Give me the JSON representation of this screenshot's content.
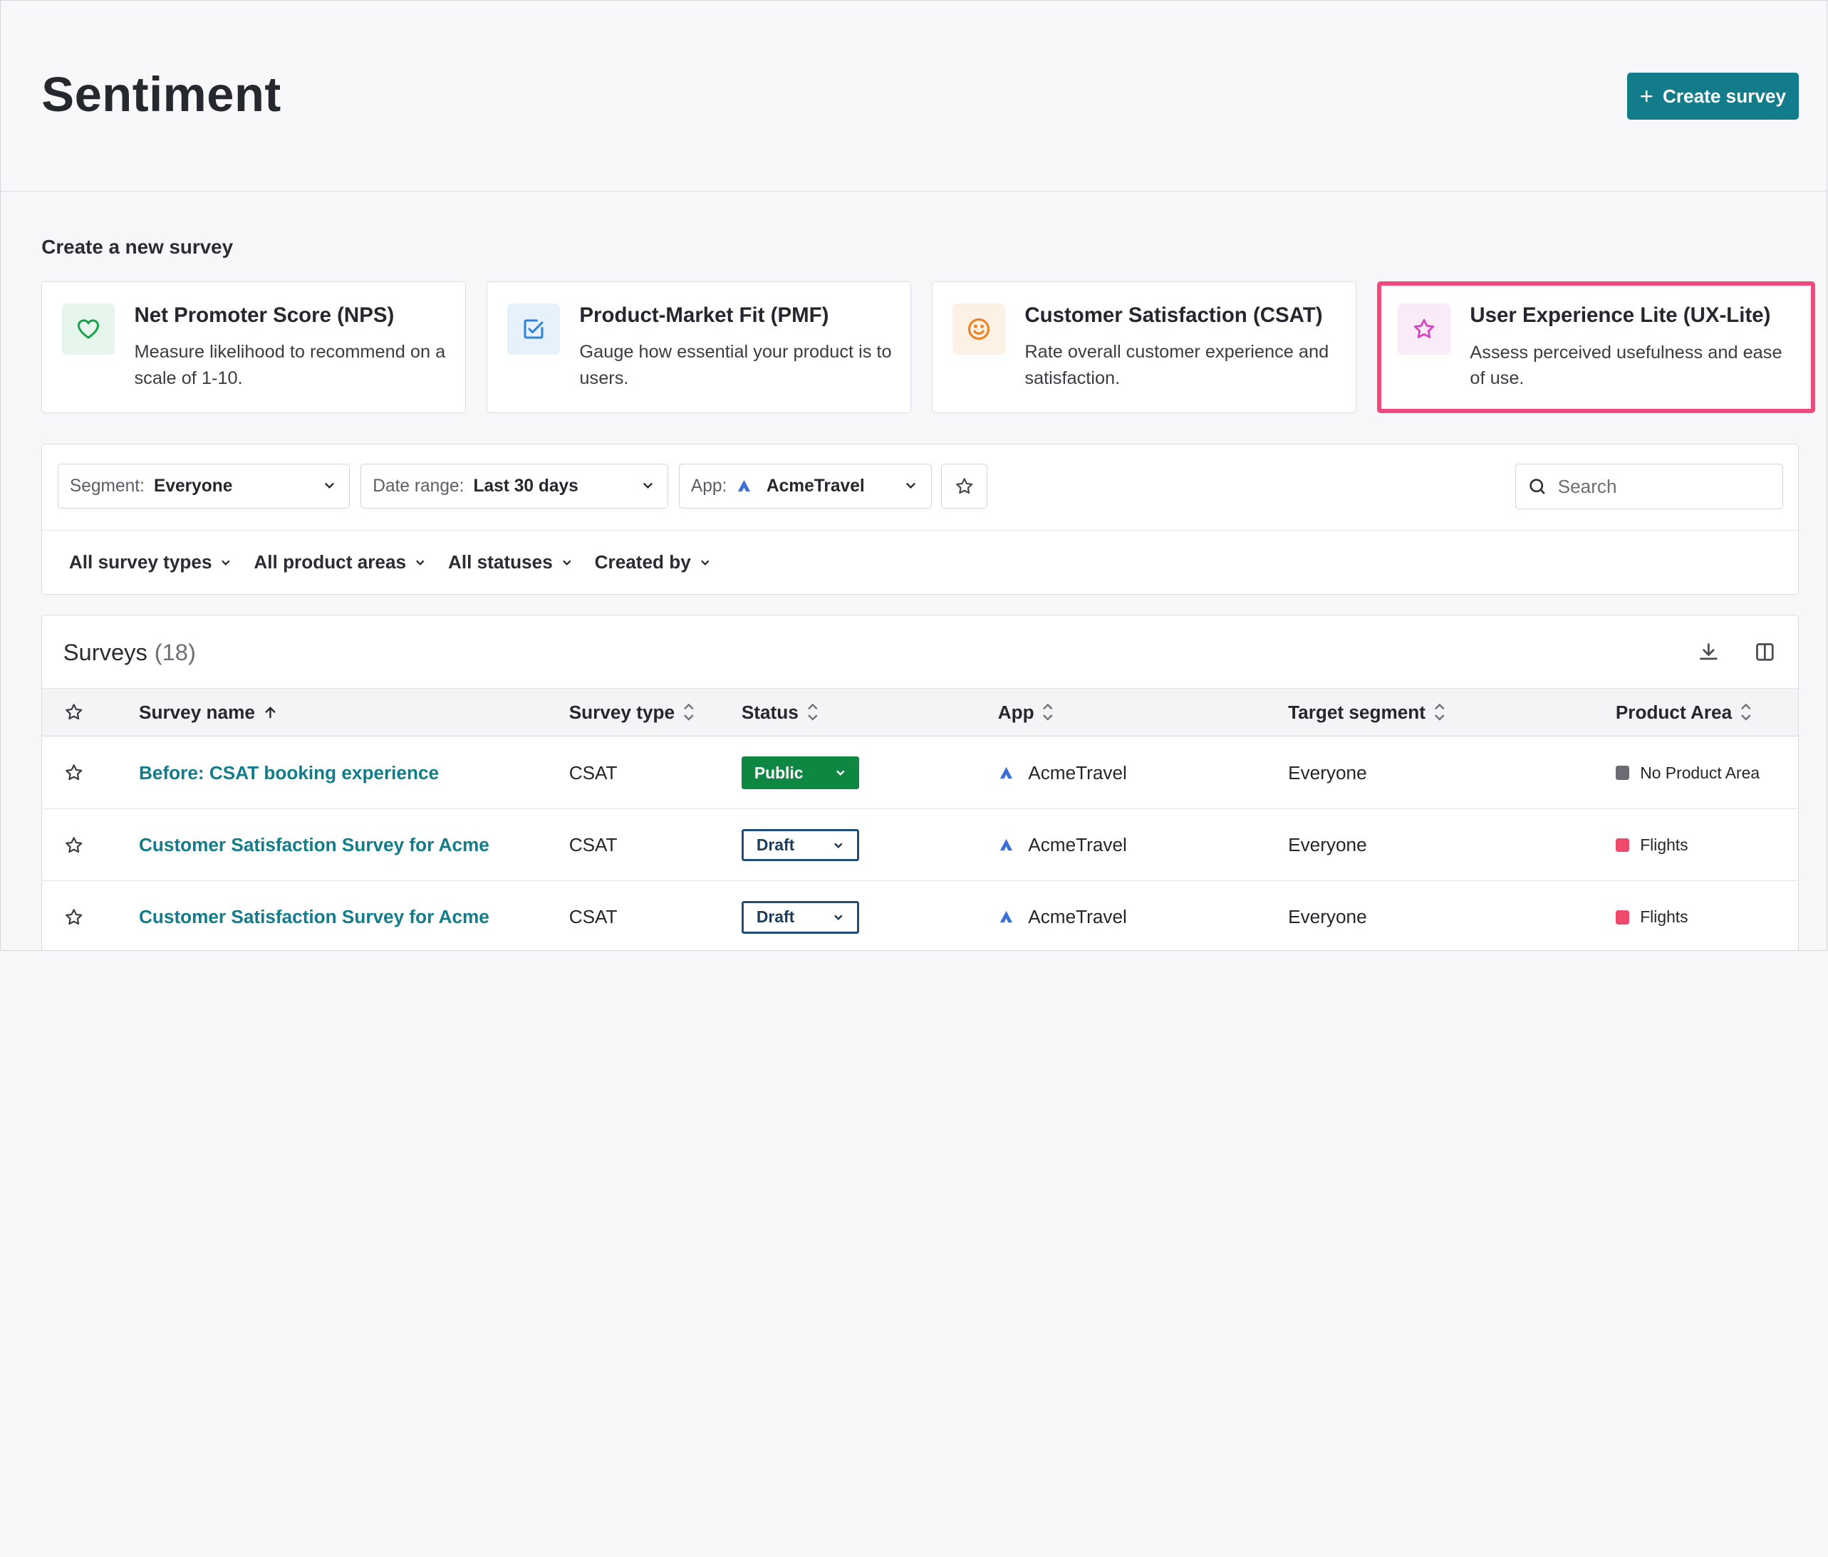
{
  "header": {
    "title": "Sentiment",
    "create_button": "Create survey"
  },
  "create_section": {
    "title": "Create a new survey",
    "cards": [
      {
        "title": "Net Promoter Score (NPS)",
        "desc": "Measure likelihood to recommend on a scale of 1-10.",
        "icon": "heart-icon",
        "color": "#1aa14d",
        "bg": "#e7f6ec"
      },
      {
        "title": "Product-Market Fit (PMF)",
        "desc": "Gauge how essential your product is to users.",
        "icon": "checkbox-icon",
        "color": "#2f83d9",
        "bg": "#e6f1fb"
      },
      {
        "title": "Customer Satisfaction (CSAT)",
        "desc": "Rate overall customer experience and satisfaction.",
        "icon": "smiley-icon",
        "color": "#f0801e",
        "bg": "#fdf1e6"
      },
      {
        "title": "User Experience Lite (UX-Lite)",
        "desc": "Assess perceived usefulness and ease of use.",
        "icon": "star-icon",
        "color": "#d63fc3",
        "bg": "#fbeaf8"
      }
    ]
  },
  "filters": {
    "segment": {
      "label": "Segment:",
      "value": "Everyone"
    },
    "date_range": {
      "label": "Date range:",
      "value": "Last 30 days"
    },
    "app": {
      "label": "App:",
      "value": "AcmeTravel"
    },
    "search_placeholder": "Search",
    "chips": [
      "All survey types",
      "All product areas",
      "All statuses",
      "Created by"
    ]
  },
  "table": {
    "title": "Surveys",
    "count": "(18)",
    "columns": [
      "Survey name",
      "Survey type",
      "Status",
      "App",
      "Target segment",
      "Product Area"
    ],
    "rows": [
      {
        "name": "Before: CSAT booking experience",
        "type": "CSAT",
        "status": "Public",
        "app": "AcmeTravel",
        "segment": "Everyone",
        "area": "No Product Area",
        "area_color": "#6a6c72"
      },
      {
        "name": "Customer Satisfaction Survey for Acme",
        "type": "CSAT",
        "status": "Draft",
        "app": "AcmeTravel",
        "segment": "Everyone",
        "area": "Flights",
        "area_color": "#ef4a6e"
      },
      {
        "name": "Customer Satisfaction Survey for Acme",
        "type": "CSAT",
        "status": "Draft",
        "app": "AcmeTravel",
        "segment": "Everyone",
        "area": "Flights",
        "area_color": "#ef4a6e"
      }
    ]
  }
}
